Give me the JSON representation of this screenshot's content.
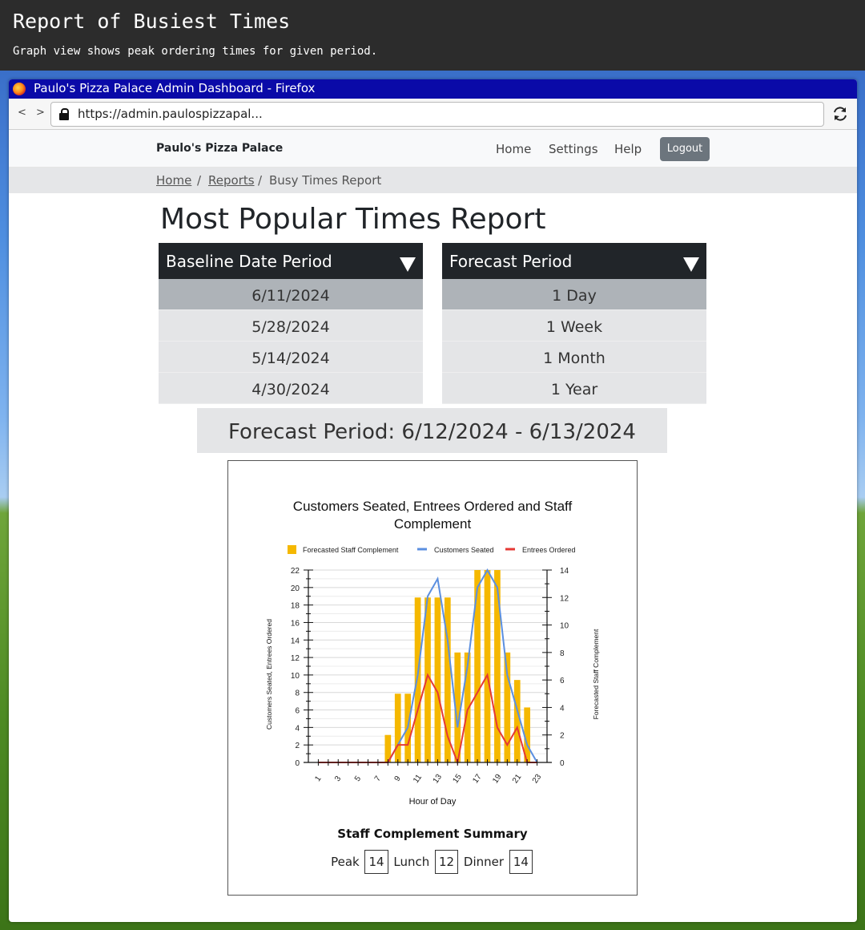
{
  "banner": {
    "title": "Report of Busiest Times",
    "subtitle": "Graph view shows peak ordering times for given period."
  },
  "window": {
    "title": "Paulo's Pizza Palace Admin Dashboard - Firefox",
    "url": "https://admin.paulospizzapal...",
    "nav_arrows": "< >"
  },
  "navbar": {
    "brand": "Paulo's Pizza Palace",
    "links": [
      "Home",
      "Settings",
      "Help"
    ],
    "logout": "Logout"
  },
  "breadcrumb": {
    "home": "Home",
    "reports": "Reports",
    "current": "Busy Times Report",
    "separator": "/"
  },
  "page": {
    "heading": "Most Popular Times Report"
  },
  "baseline": {
    "label": "Baseline Date Period",
    "options": [
      "6/11/2024",
      "5/28/2024",
      "5/14/2024",
      "4/30/2024"
    ],
    "selected": "6/11/2024"
  },
  "forecast": {
    "label": "Forecast Period",
    "options": [
      "1 Day",
      "1 Week",
      "1 Month",
      "1 Year"
    ],
    "selected": "1 Day",
    "banner": "Forecast Period: 6/12/2024 - 6/13/2024"
  },
  "chart_data": {
    "type": "bar",
    "title": "Customers Seated, Entrees Ordered and Staff Complement",
    "xlabel": "Hour of Day",
    "ylabel": "Customers Seated, Entrees Ordered",
    "y2label": "Forecasted Staff Complement",
    "ylim": [
      0,
      22
    ],
    "y2lim": [
      0,
      14
    ],
    "x": [
      1,
      2,
      3,
      4,
      5,
      6,
      7,
      8,
      9,
      10,
      11,
      12,
      13,
      14,
      15,
      16,
      17,
      18,
      19,
      20,
      21,
      22,
      23
    ],
    "x_tick_labels": [
      "1",
      "3",
      "5",
      "7",
      "9",
      "11",
      "13",
      "15",
      "17",
      "19",
      "21",
      "23"
    ],
    "y_tick_labels": [
      "0",
      "2",
      "4",
      "6",
      "8",
      "10",
      "12",
      "14",
      "16",
      "18",
      "20",
      "22"
    ],
    "y2_tick_labels": [
      "0",
      "2",
      "4",
      "6",
      "8",
      "10",
      "12",
      "14"
    ],
    "legend_position": "top",
    "series": [
      {
        "name": "Forecasted Staff Complement",
        "kind": "bar",
        "axis": "right",
        "color": "#f5b800",
        "values": [
          0,
          0,
          0,
          0,
          0,
          0,
          0,
          2,
          5,
          5,
          12,
          12,
          12,
          12,
          8,
          8,
          14,
          14,
          14,
          8,
          6,
          4,
          0
        ]
      },
      {
        "name": "Customers Seated",
        "kind": "line",
        "axis": "left",
        "color": "#5b8fe0",
        "values": [
          0,
          0,
          0,
          0,
          0,
          0,
          0,
          0,
          2,
          4,
          10,
          19,
          21,
          14,
          4,
          11,
          20,
          22,
          20,
          10,
          6,
          2,
          0
        ]
      },
      {
        "name": "Entrees Ordered",
        "kind": "line",
        "axis": "left",
        "color": "#e53935",
        "values": [
          0,
          0,
          0,
          0,
          0,
          0,
          0,
          0,
          2,
          2,
          6,
          10,
          8,
          3,
          0,
          6,
          8,
          10,
          4,
          2,
          4,
          0,
          0
        ]
      }
    ]
  },
  "summary": {
    "title": "Staff Complement Summary",
    "peak_label": "Peak",
    "peak": "14",
    "lunch_label": "Lunch",
    "lunch": "12",
    "dinner_label": "Dinner",
    "dinner": "14"
  }
}
